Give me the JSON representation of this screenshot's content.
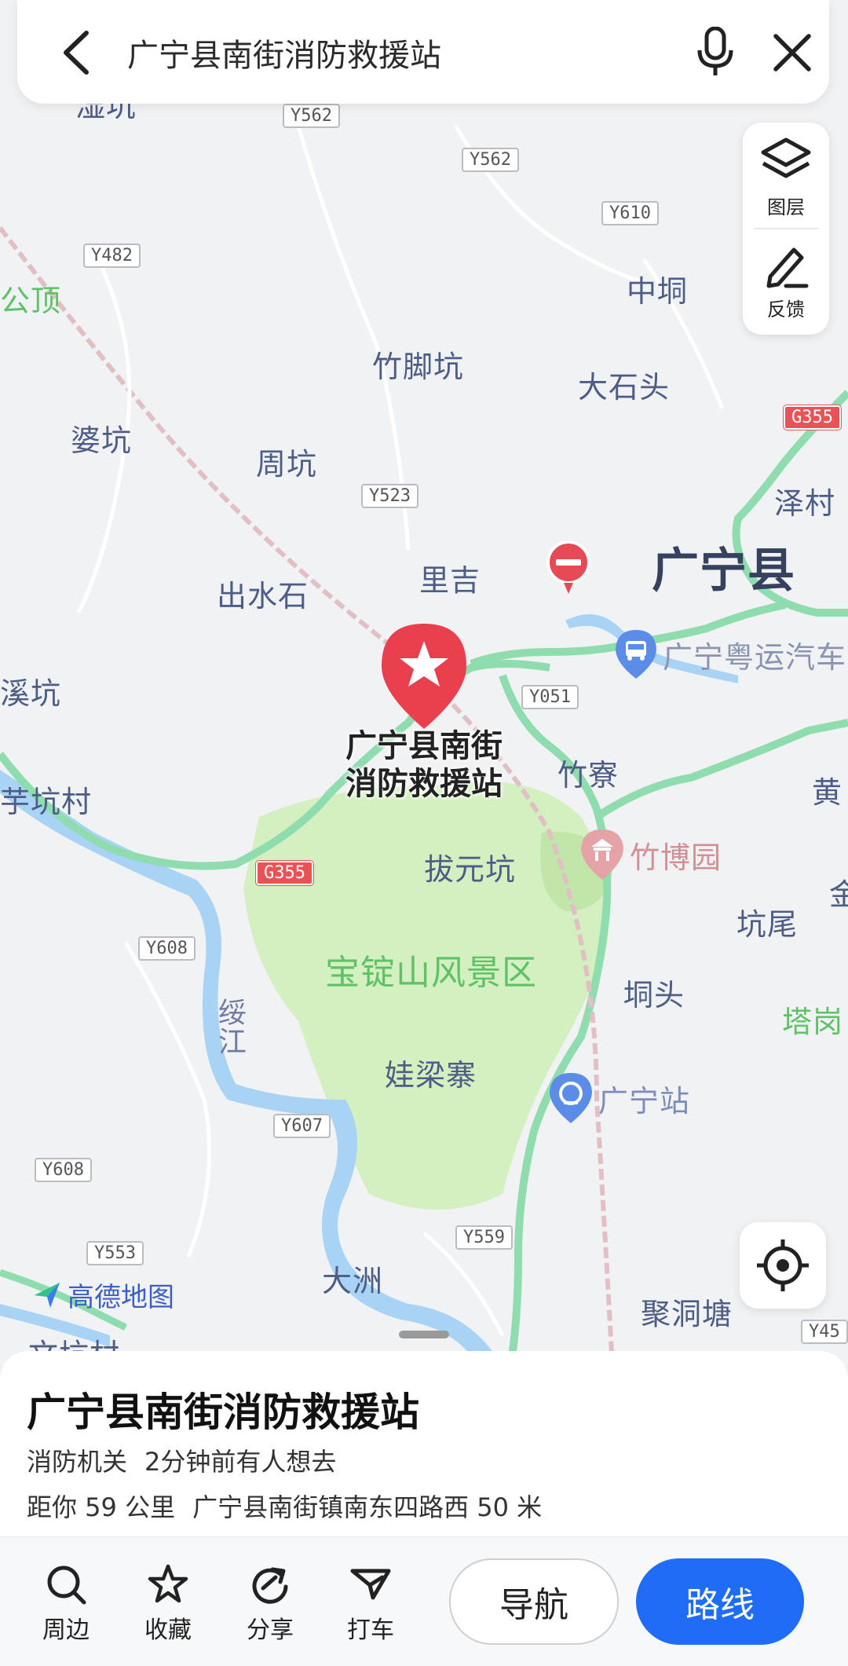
{
  "search": {
    "query": "广宁县南街消防救援站"
  },
  "tools": {
    "layers_label": "图层",
    "feedback_label": "反馈"
  },
  "map": {
    "labels": {
      "top_clip": "湿坑",
      "gongding": "公顶",
      "zhongtong": "中垌",
      "zhujiaokeng": "竹脚坑",
      "dashitou": "大石头",
      "pokeng": "婆坑",
      "zhoukeng": "周坑",
      "zecun": "泽村",
      "guangning": "广宁县",
      "liji": "里吉",
      "chushuishi": "出水石",
      "xikeng": "溪坑",
      "yukengcun": "芋坑村",
      "zhuzhai": "竹寮",
      "bayuankeng": "拔元坑",
      "huang": "黄",
      "kengwei": "坑尾",
      "jin": "金",
      "baodingshan": "宝锭山风景区",
      "dongtou": "垌头",
      "tagang": "塔岗",
      "waliangzhai": "娃梁寨",
      "suijiang": "绥江",
      "dazhou": "大洲",
      "judongtang": "聚洞塘",
      "wenkengcun": "文坑村"
    },
    "pois": {
      "bus": "广宁粤运汽车",
      "zhubo": "竹博园",
      "station": "广宁站"
    },
    "roads": {
      "y562a": "Y562",
      "y562b": "Y562",
      "y610": "Y610",
      "y482": "Y482",
      "g355a": "G355",
      "y523": "Y523",
      "y051": "Y051",
      "g355b": "G355",
      "y608a": "Y608",
      "y607": "Y607",
      "y608b": "Y608",
      "y553": "Y553",
      "y559": "Y559",
      "y45": "Y45"
    },
    "marker_title": "广宁县南街\n消防救援站",
    "logo": "高德地图"
  },
  "place": {
    "name": "广宁县南街消防救援站",
    "category": "消防机关",
    "recent": "2分钟前有人想去",
    "distance": "距你 59 公里",
    "address": "广宁县南街镇南东四路西 50 米"
  },
  "actions": {
    "nearby": "周边",
    "favorite": "收藏",
    "share": "分享",
    "taxi": "打车",
    "navigate": "导航",
    "route": "路线"
  },
  "colors": {
    "accent": "#1f6cf6",
    "marker": "#ea3f4d",
    "park": "#d4efc0",
    "river": "#a9d3f5",
    "road_green": "#8fdcae"
  }
}
